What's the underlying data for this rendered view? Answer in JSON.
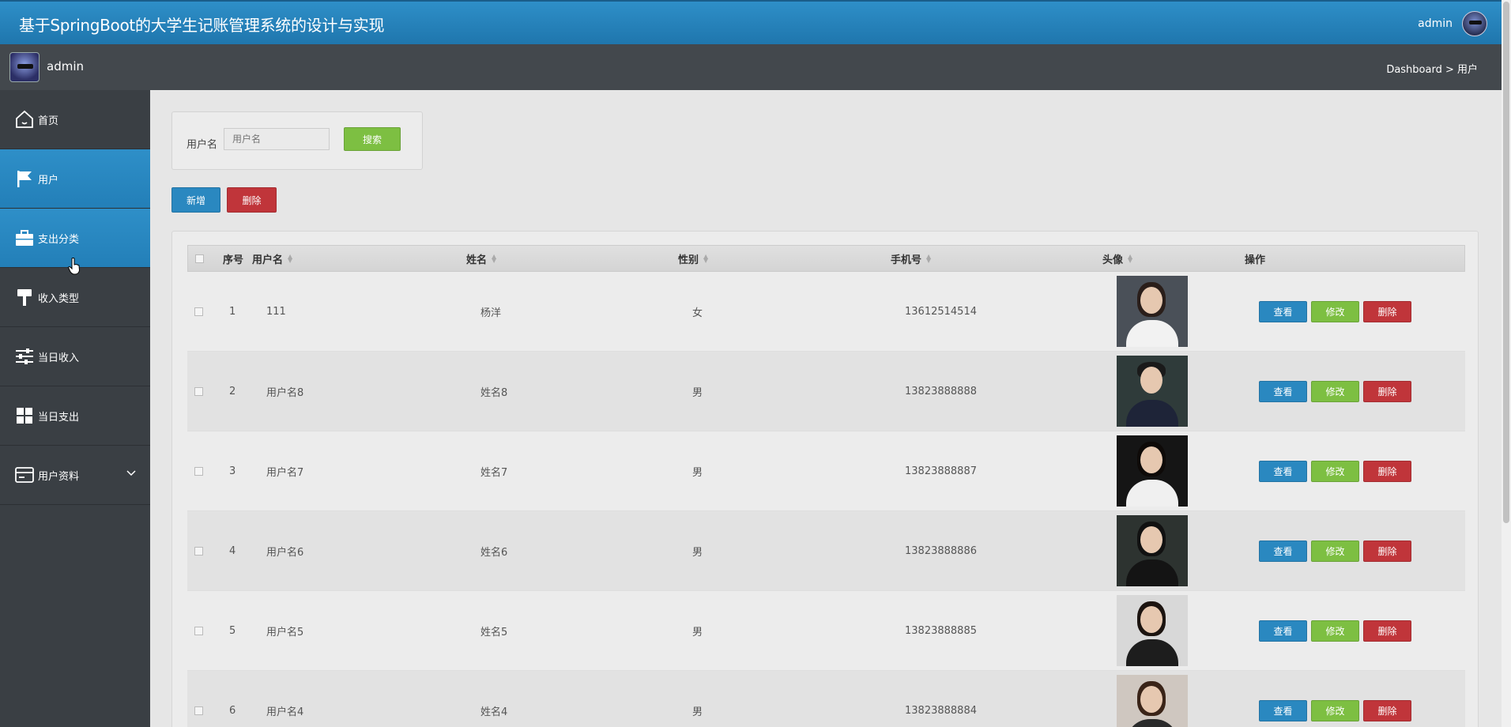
{
  "header": {
    "title": "基于SpringBoot的大学生记账管理系统的设计与实现",
    "user": "admin"
  },
  "subbar": {
    "name": "admin",
    "breadcrumb": "Dashboard > 用户"
  },
  "sidebar": {
    "items": [
      {
        "label": "首页",
        "icon": "home-icon"
      },
      {
        "label": "用户",
        "icon": "flag-icon"
      },
      {
        "label": "支出分类",
        "icon": "briefcase-icon"
      },
      {
        "label": "收入类型",
        "icon": "paint-roller-icon"
      },
      {
        "label": "当日收入",
        "icon": "sliders-icon"
      },
      {
        "label": "当日支出",
        "icon": "grid-icon"
      },
      {
        "label": "用户资料",
        "icon": "card-icon"
      }
    ]
  },
  "search": {
    "label": "用户名",
    "placeholder": "用户名",
    "button": "搜索"
  },
  "actions": {
    "add": "新增",
    "delete": "删除"
  },
  "table": {
    "columns": [
      "序号",
      "用户名",
      "姓名",
      "性别",
      "手机号",
      "头像",
      "操作"
    ],
    "row_actions": {
      "view": "查看",
      "edit": "修改",
      "delete": "删除"
    },
    "rows": [
      {
        "no": "1",
        "username": "111",
        "name": "杨洋",
        "gender": "女",
        "phone": "13612514514"
      },
      {
        "no": "2",
        "username": "用户名8",
        "name": "姓名8",
        "gender": "男",
        "phone": "13823888888"
      },
      {
        "no": "3",
        "username": "用户名7",
        "name": "姓名7",
        "gender": "男",
        "phone": "13823888887"
      },
      {
        "no": "4",
        "username": "用户名6",
        "name": "姓名6",
        "gender": "男",
        "phone": "13823888886"
      },
      {
        "no": "5",
        "username": "用户名5",
        "name": "姓名5",
        "gender": "男",
        "phone": "13823888885"
      },
      {
        "no": "6",
        "username": "用户名4",
        "name": "姓名4",
        "gender": "男",
        "phone": "13823888884"
      }
    ]
  },
  "colors": {
    "primary": "#2a88c0",
    "success": "#7dbf42",
    "danger": "#c0353a",
    "sidebar": "#3a3f44"
  }
}
